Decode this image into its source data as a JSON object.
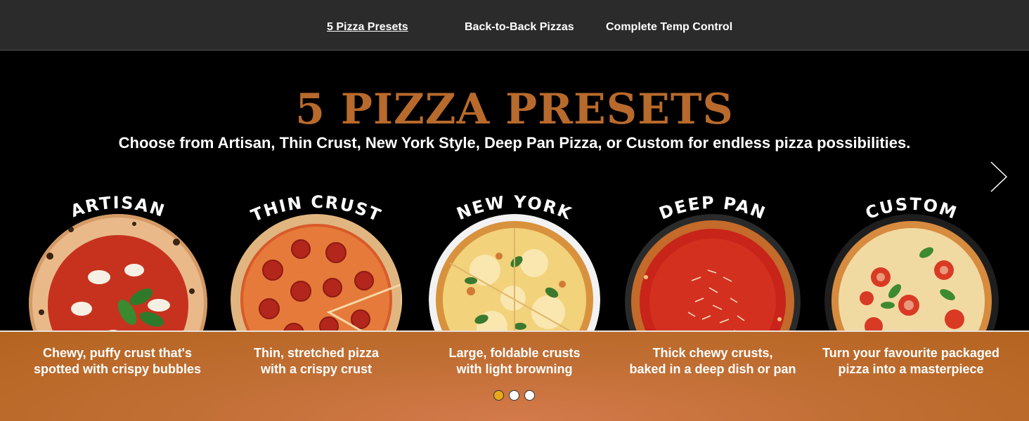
{
  "nav": {
    "items": [
      {
        "label": "5 Pizza Presets",
        "active": true
      },
      {
        "label": "Back-to-Back Pizzas",
        "active": false
      },
      {
        "label": "Complete Temp Control",
        "active": false
      }
    ]
  },
  "hero": {
    "title": "5 PIZZA PRESETS",
    "subtitle": "Choose from Artisan, Thin Crust, New York Style, Deep Pan Pizza, or Custom for endless pizza possibilities.",
    "title_color": "#b86a2c",
    "next_icon": "chevron-right-icon"
  },
  "presets": [
    {
      "name": "ARTISAN",
      "caption_line1": "Chewy, puffy crust that's",
      "caption_line2": "spotted with crispy bubbles"
    },
    {
      "name": "THIN CRUST",
      "caption_line1": "Thin, stretched pizza",
      "caption_line2": "with a crispy crust"
    },
    {
      "name": "NEW YORK",
      "caption_line1": "Large, foldable crusts",
      "caption_line2": "with light browning"
    },
    {
      "name": "DEEP PAN",
      "caption_line1": "Thick chewy crusts,",
      "caption_line2": "baked in a deep dish or pan"
    },
    {
      "name": "CUSTOM",
      "caption_line1": "Turn your favourite packaged",
      "caption_line2": "pizza into a masterpiece"
    }
  ],
  "carousel": {
    "dots": 3,
    "active_index": 0,
    "active_color": "#e7a81a"
  }
}
